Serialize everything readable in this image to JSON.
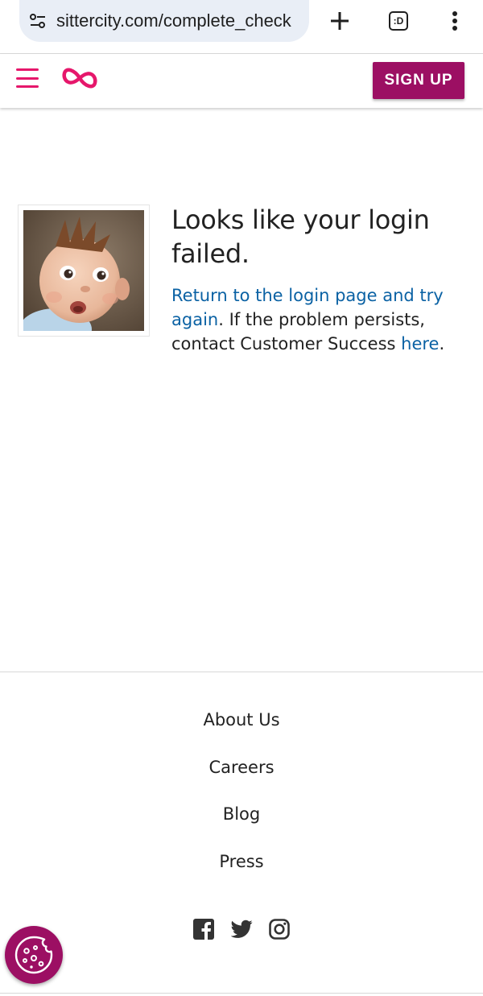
{
  "browser": {
    "url": "sittercity.com/complete_check",
    "tab_count": ":D"
  },
  "header": {
    "signup_label": "SIGN UP"
  },
  "message": {
    "heading": "Looks like your login failed.",
    "return_link": "Return to the login page and try again",
    "middle_text": ". If the problem persists, contact Customer Success ",
    "here_link": "here",
    "end_text": "."
  },
  "footer": {
    "links": [
      "About Us",
      "Careers",
      "Blog",
      "Press"
    ],
    "social_icons": [
      "facebook-icon",
      "twitter-icon",
      "instagram-icon"
    ]
  },
  "colors": {
    "brand": "#9c0f63",
    "logo_pink": "#e6176b",
    "link": "#0b62a4"
  }
}
